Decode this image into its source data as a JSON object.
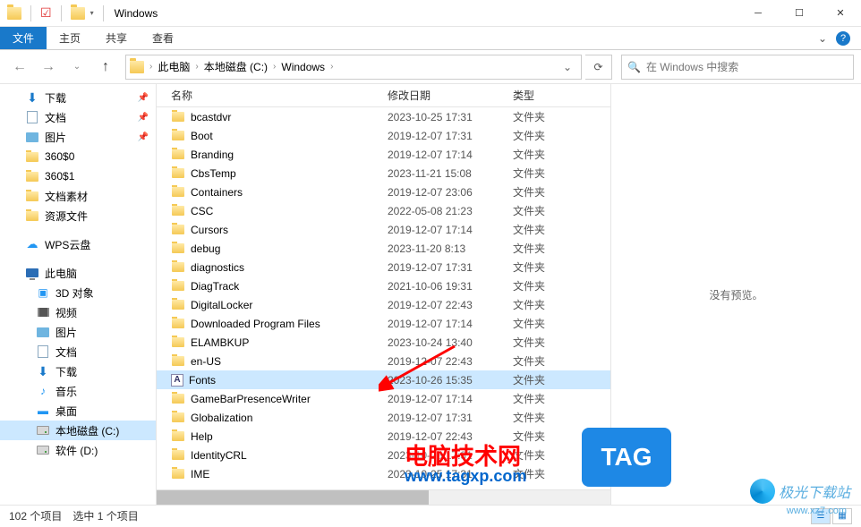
{
  "window": {
    "title": "Windows"
  },
  "ribbon": {
    "file": "文件",
    "tabs": [
      "主页",
      "共享",
      "查看"
    ]
  },
  "breadcrumb": {
    "items": [
      "此电脑",
      "本地磁盘 (C:)",
      "Windows"
    ]
  },
  "search": {
    "placeholder": "在 Windows 中搜索"
  },
  "navpane": {
    "quick": [
      {
        "label": "下载",
        "icon": "download",
        "pin": true
      },
      {
        "label": "文档",
        "icon": "doc",
        "pin": true
      },
      {
        "label": "图片",
        "icon": "pic",
        "pin": true
      },
      {
        "label": "360$0",
        "icon": "folder"
      },
      {
        "label": "360$1",
        "icon": "folder"
      },
      {
        "label": "文档素材",
        "icon": "folder"
      },
      {
        "label": "资源文件",
        "icon": "folder"
      }
    ],
    "cloud": {
      "label": "WPS云盘"
    },
    "pc": {
      "label": "此电脑"
    },
    "pc_items": [
      {
        "label": "3D 对象",
        "icon": "3d"
      },
      {
        "label": "视频",
        "icon": "video"
      },
      {
        "label": "图片",
        "icon": "pic"
      },
      {
        "label": "文档",
        "icon": "doc"
      },
      {
        "label": "下载",
        "icon": "download"
      },
      {
        "label": "音乐",
        "icon": "music"
      },
      {
        "label": "桌面",
        "icon": "desk"
      },
      {
        "label": "本地磁盘 (C:)",
        "icon": "drive",
        "selected": true
      },
      {
        "label": "软件 (D:)",
        "icon": "drive"
      }
    ]
  },
  "columns": {
    "name": "名称",
    "date": "修改日期",
    "type": "类型"
  },
  "files": [
    {
      "name": "bcastdvr",
      "date": "2023-10-25 17:31",
      "type": "文件夹",
      "icon": "folder"
    },
    {
      "name": "Boot",
      "date": "2019-12-07 17:31",
      "type": "文件夹",
      "icon": "folder"
    },
    {
      "name": "Branding",
      "date": "2019-12-07 17:14",
      "type": "文件夹",
      "icon": "folder"
    },
    {
      "name": "CbsTemp",
      "date": "2023-11-21 15:08",
      "type": "文件夹",
      "icon": "folder"
    },
    {
      "name": "Containers",
      "date": "2019-12-07 23:06",
      "type": "文件夹",
      "icon": "folder"
    },
    {
      "name": "CSC",
      "date": "2022-05-08 21:23",
      "type": "文件夹",
      "icon": "folder"
    },
    {
      "name": "Cursors",
      "date": "2019-12-07 17:14",
      "type": "文件夹",
      "icon": "folder"
    },
    {
      "name": "debug",
      "date": "2023-11-20 8:13",
      "type": "文件夹",
      "icon": "folder"
    },
    {
      "name": "diagnostics",
      "date": "2019-12-07 17:31",
      "type": "文件夹",
      "icon": "folder"
    },
    {
      "name": "DiagTrack",
      "date": "2021-10-06 19:31",
      "type": "文件夹",
      "icon": "folder"
    },
    {
      "name": "DigitalLocker",
      "date": "2019-12-07 22:43",
      "type": "文件夹",
      "icon": "folder"
    },
    {
      "name": "Downloaded Program Files",
      "date": "2019-12-07 17:14",
      "type": "文件夹",
      "icon": "folder"
    },
    {
      "name": "ELAMBKUP",
      "date": "2023-10-24 13:40",
      "type": "文件夹",
      "icon": "folder"
    },
    {
      "name": "en-US",
      "date": "2019-12-07 22:43",
      "type": "文件夹",
      "icon": "folder"
    },
    {
      "name": "Fonts",
      "date": "2023-10-26 15:35",
      "type": "文件夹",
      "icon": "fonts",
      "selected": true
    },
    {
      "name": "GameBarPresenceWriter",
      "date": "2019-12-07 17:14",
      "type": "文件夹",
      "icon": "folder"
    },
    {
      "name": "Globalization",
      "date": "2019-12-07 17:31",
      "type": "文件夹",
      "icon": "folder"
    },
    {
      "name": "Help",
      "date": "2019-12-07 22:43",
      "type": "文件夹",
      "icon": "folder"
    },
    {
      "name": "IdentityCRL",
      "date": "2023-10-25 17:31",
      "type": "文件夹",
      "icon": "folder"
    },
    {
      "name": "IME",
      "date": "2023-10-25 17:31",
      "type": "文件夹",
      "icon": "folder"
    }
  ],
  "preview": {
    "empty": "没有预览。"
  },
  "status": {
    "count": "102 个项目",
    "selection": "选中 1 个项目"
  },
  "watermarks": {
    "w1a": "电脑技术网",
    "w1b": "www.tagxp.com",
    "tag": "TAG",
    "w2": "极光下载站",
    "w2sub": "www.xz7.com"
  }
}
